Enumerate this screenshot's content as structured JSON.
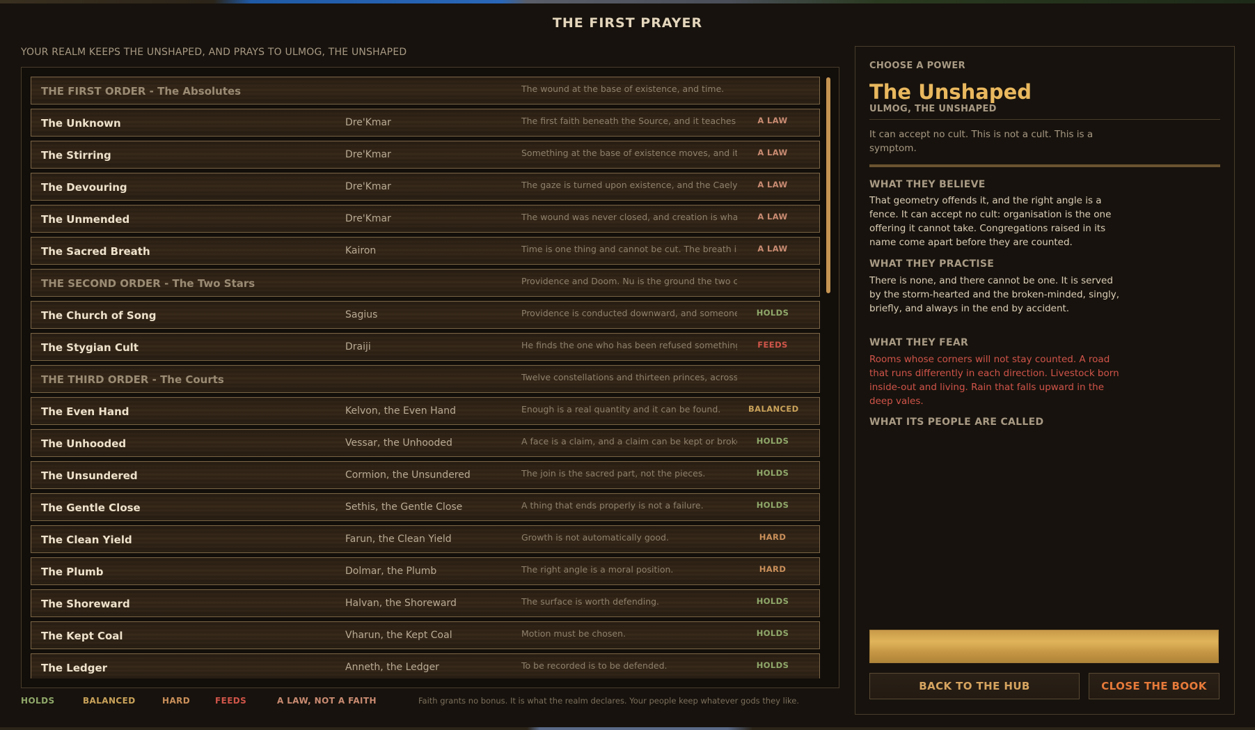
{
  "title": "THE FIRST PRAYER",
  "subtitle": "YOUR REALM KEEPS THE UNSHAPED, AND PRAYS TO ULMOG, THE UNSHAPED",
  "rows": [
    {
      "name": "THE FIRST ORDER  -  The Absolutes",
      "deity": "",
      "desc": "The wound at the base of existence, and time.",
      "tag": "",
      "kind": "header"
    },
    {
      "name": "The Unknown",
      "deity": "Dre'Kmar",
      "desc": "The first faith beneath the Source, and it teaches no...",
      "tag": "A LAW",
      "kind": "law"
    },
    {
      "name": "The Stirring",
      "deity": "Dre'Kmar",
      "desc": "Something at the base of existence moves, and it di...",
      "tag": "A LAW",
      "kind": "law"
    },
    {
      "name": "The Devouring",
      "deity": "Dre'Kmar",
      "desc": "The gaze is turned upon existence, and the Caelyre...",
      "tag": "A LAW",
      "kind": "law"
    },
    {
      "name": "The Unmended",
      "deity": "Dre'Kmar",
      "desc": "The wound was never closed, and creation is what ...",
      "tag": "A LAW",
      "kind": "law"
    },
    {
      "name": "The Sacred Breath",
      "deity": "Kairon",
      "desc": "Time is one thing and cannot be cut. The breath is t...",
      "tag": "A LAW",
      "kind": "law"
    },
    {
      "name": "THE SECOND ORDER  -  The Two Stars",
      "deity": "",
      "desc": "Providence and Doom. Nu is the ground the two co...",
      "tag": "",
      "kind": "header"
    },
    {
      "name": "The Church of Song",
      "deity": "Sagius",
      "desc": "Providence is conducted downward, and someone ...",
      "tag": "HOLDS",
      "kind": "holds"
    },
    {
      "name": "The Stygian Cult",
      "deity": "Draiji",
      "desc": "He finds the one who has been refused something, ...",
      "tag": "FEEDS",
      "kind": "feeds"
    },
    {
      "name": "THE THIRD ORDER  -  The Courts",
      "deity": "",
      "desc": "Twelve constellations and thirteen princes, across t...",
      "tag": "",
      "kind": "header"
    },
    {
      "name": "The Even Hand",
      "deity": "Kelvon, the Even Hand",
      "desc": "Enough is a real quantity and it can be found.",
      "tag": "BALANCED",
      "kind": "balanced"
    },
    {
      "name": "The Unhooded",
      "deity": "Vessar, the Unhooded",
      "desc": "A face is a claim, and a claim can be kept or broken.",
      "tag": "HOLDS",
      "kind": "holds"
    },
    {
      "name": "The Unsundered",
      "deity": "Cormion, the Unsundered",
      "desc": "The join is the sacred part, not the pieces.",
      "tag": "HOLDS",
      "kind": "holds"
    },
    {
      "name": "The Gentle Close",
      "deity": "Sethis, the Gentle Close",
      "desc": "A thing that ends properly is not a failure.",
      "tag": "HOLDS",
      "kind": "holds"
    },
    {
      "name": "The Clean Yield",
      "deity": "Farun, the Clean Yield",
      "desc": "Growth is not automatically good.",
      "tag": "HARD",
      "kind": "hard"
    },
    {
      "name": "The Plumb",
      "deity": "Dolmar, the Plumb",
      "desc": "The right angle is a moral position.",
      "tag": "HARD",
      "kind": "hard"
    },
    {
      "name": "The Shoreward",
      "deity": "Halvan, the Shoreward",
      "desc": "The surface is worth defending.",
      "tag": "HOLDS",
      "kind": "holds"
    },
    {
      "name": "The Kept Coal",
      "deity": "Vharun, the Kept Coal",
      "desc": "Motion must be chosen.",
      "tag": "HOLDS",
      "kind": "holds"
    },
    {
      "name": "The Ledger",
      "deity": "Anneth, the Ledger",
      "desc": "To be recorded is to be defended.",
      "tag": "HOLDS",
      "kind": "holds"
    }
  ],
  "legend": {
    "holds": "HOLDS",
    "balanced": "BALANCED",
    "hard": "HARD",
    "feeds": "FEEDS",
    "law": "A LAW, NOT A FAITH",
    "note": "Faith grants no bonus. It is what the realm declares. Your people keep whatever gods they like."
  },
  "detail": {
    "choose": "CHOOSE A POWER",
    "name": "The Unshaped",
    "sub": "ULMOG, THE UNSHAPED",
    "blurb": "It can accept no cult. This is not a cult. This is a symptom.",
    "believe_head": "WHAT THEY BELIEVE",
    "believe": "That geometry offends it, and the right angle is a fence. It can accept no cult: organisation is the one offering it cannot take. Congregations raised in its name come apart before they are counted.",
    "practise_head": "WHAT THEY PRACTISE",
    "practise": "There is none, and there cannot be one. It is served by the storm-hearted and the broken-minded, singly, briefly, and always in the end by accident.",
    "fear_head": "WHAT THEY FEAR",
    "fear": "Rooms whose corners will not stay counted. A road that runs differently in each direction. Livestock born inside-out and living. Rain that falls upward in the deep vales.",
    "called_head": "WHAT ITS PEOPLE ARE CALLED",
    "back_button": "BACK TO THE HUB",
    "close_button": "CLOSE THE BOOK"
  },
  "colors": {
    "holds": "#8fa86a",
    "balanced": "#c9a25a",
    "hard": "#c98f5a",
    "feeds": "#d0554a",
    "law": "#c98b72",
    "accent_gold": "#e9b85e"
  }
}
